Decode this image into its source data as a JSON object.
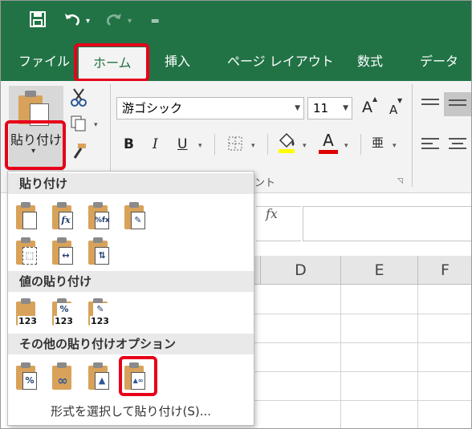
{
  "qat": {
    "save_icon": "save-icon",
    "undo_icon": "undo-icon",
    "redo_icon": "redo-icon",
    "customize_icon": "customize-qat-icon"
  },
  "tabs": [
    {
      "label": "ファイル",
      "active": false
    },
    {
      "label": "ホーム",
      "active": true
    },
    {
      "label": "挿入",
      "active": false
    },
    {
      "label": "ページ レイアウト",
      "active": false
    },
    {
      "label": "数式",
      "active": false
    },
    {
      "label": "データ",
      "active": false
    }
  ],
  "ribbon": {
    "paste_label": "貼り付け",
    "font_name": "游ゴシック",
    "font_size": "11",
    "grow_font": "A",
    "shrink_font": "A",
    "bold": "B",
    "italic": "I",
    "underline": "U",
    "font_color_letter": "A",
    "phonetic_glyph": "亜",
    "group_font_tail": "ント"
  },
  "formula_bar": {
    "fx_label": "fx"
  },
  "grid": {
    "columns": [
      "D",
      "E",
      "F"
    ]
  },
  "paste_menu": {
    "section_paste": "貼り付け",
    "section_values": "値の貼り付け",
    "section_other": "その他の貼り付けオプション",
    "paste_items": [
      {
        "icon": "paste-icon",
        "glyph": ""
      },
      {
        "icon": "paste-formulas-icon",
        "glyph": "fx"
      },
      {
        "icon": "paste-formulas-number-format-icon",
        "glyph": "%fx"
      },
      {
        "icon": "keep-source-formatting-icon",
        "glyph": "✎"
      },
      {
        "icon": "no-borders-icon",
        "glyph": "⬚"
      },
      {
        "icon": "keep-column-widths-icon",
        "glyph": "↔"
      },
      {
        "icon": "transpose-icon",
        "glyph": "⇅"
      }
    ],
    "value_items": [
      {
        "icon": "values-icon",
        "glyph": "",
        "num": "123"
      },
      {
        "icon": "values-number-format-icon",
        "glyph": "%",
        "num": "123"
      },
      {
        "icon": "values-source-formatting-icon",
        "glyph": "✎",
        "num": "123"
      }
    ],
    "other_items": [
      {
        "icon": "formatting-icon",
        "glyph": "%"
      },
      {
        "icon": "paste-link-icon",
        "glyph": "∞"
      },
      {
        "icon": "picture-icon",
        "glyph": "▲"
      },
      {
        "icon": "linked-picture-icon",
        "glyph": "▲∞"
      }
    ],
    "footer_label": "形式を選択して貼り付け(S)..."
  }
}
